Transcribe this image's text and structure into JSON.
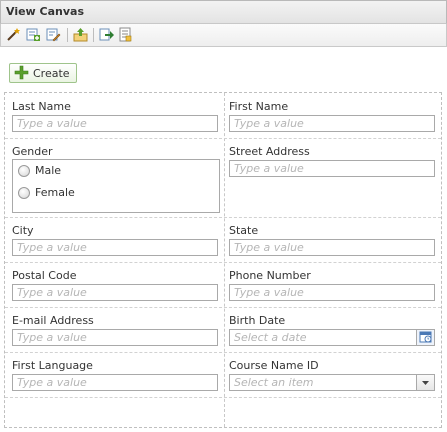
{
  "window": {
    "title": "View Canvas"
  },
  "toolbar": {
    "buttons": [
      {
        "icon": "magic-wand-icon"
      },
      {
        "icon": "add-field-icon"
      },
      {
        "icon": "edit-form-icon"
      },
      {
        "icon": "upload-icon"
      },
      {
        "icon": "export-icon"
      },
      {
        "icon": "properties-icon"
      }
    ]
  },
  "actions": {
    "create_label": "Create"
  },
  "form": {
    "last_name": {
      "label": "Last Name",
      "placeholder": "Type a value"
    },
    "first_name": {
      "label": "First Name",
      "placeholder": "Type a value"
    },
    "gender": {
      "label": "Gender",
      "options": [
        "Male",
        "Female"
      ]
    },
    "street_address": {
      "label": "Street Address",
      "placeholder": "Type a value"
    },
    "city": {
      "label": "City",
      "placeholder": "Type a value"
    },
    "state": {
      "label": "State",
      "placeholder": "Type a value"
    },
    "postal_code": {
      "label": "Postal Code",
      "placeholder": "Type a value"
    },
    "phone_number": {
      "label": "Phone Number",
      "placeholder": "Type a value"
    },
    "email": {
      "label": "E-mail Address",
      "placeholder": "Type a value"
    },
    "birth_date": {
      "label": "Birth Date",
      "placeholder": "Select a date"
    },
    "first_language": {
      "label": "First Language",
      "placeholder": "Type a value"
    },
    "course_name_id": {
      "label": "Course Name ID",
      "placeholder": "Select an item"
    }
  },
  "colors": {
    "accent_green": "#5aa02c",
    "placeholder": "#b5b5b5",
    "border": "#a9a9a9"
  }
}
